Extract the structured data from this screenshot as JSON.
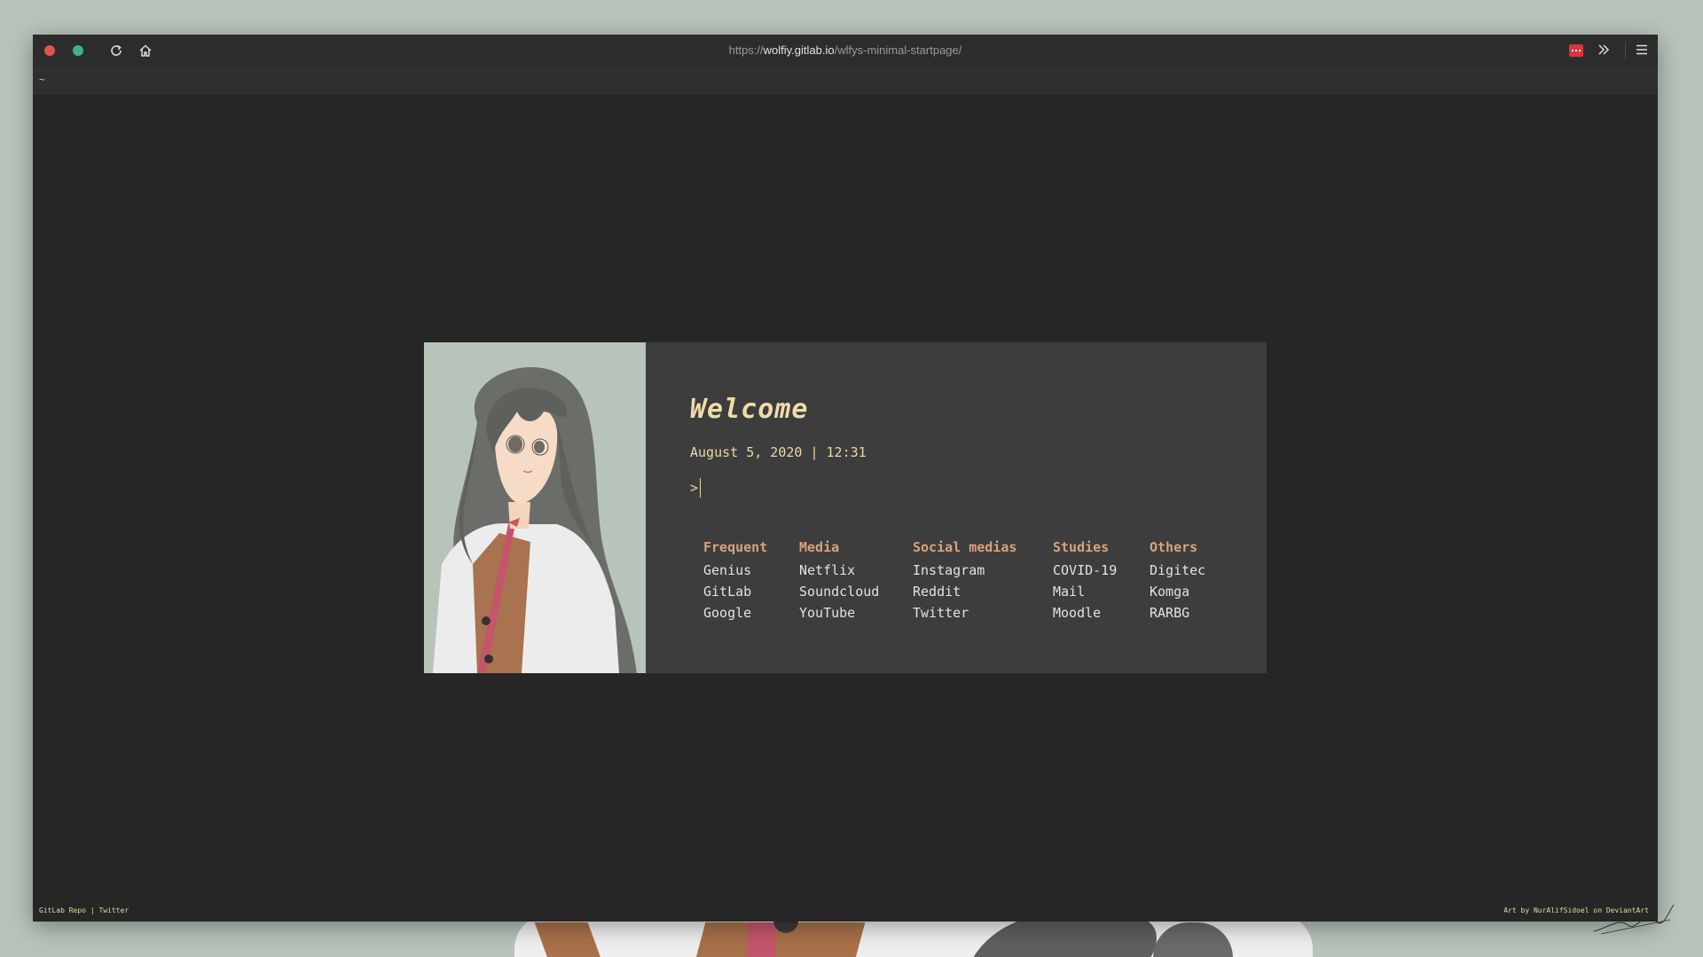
{
  "browser": {
    "url_scheme": "https://",
    "url_host": "wolfiy.gitlab.io",
    "url_path": "/wlfys-minimal-startpage/",
    "tab_title": "~"
  },
  "startpage": {
    "welcome": "Welcome",
    "datetime": "August 5, 2020 | 12:31",
    "prompt": ">",
    "columns": [
      {
        "heading": "Frequent",
        "links": [
          "Genius",
          "GitLab",
          "Google"
        ]
      },
      {
        "heading": "Media",
        "links": [
          "Netflix",
          "Soundcloud",
          "YouTube"
        ]
      },
      {
        "heading": "Social medias",
        "links": [
          "Instagram",
          "Reddit",
          "Twitter"
        ]
      },
      {
        "heading": "Studies",
        "links": [
          "COVID-19",
          "Mail",
          "Moodle"
        ]
      },
      {
        "heading": "Others",
        "links": [
          "Digitec",
          "Komga",
          "RARBG"
        ]
      }
    ]
  },
  "footer": {
    "left_link1": "GitLab Repo",
    "left_sep": "|",
    "left_link2": "Twitter",
    "right": "Art by NurAlifSidoel on DeviantArt"
  },
  "colors": {
    "background": "#262626",
    "card": "#3d3d3d",
    "accent_heading": "#d9a27a",
    "accent_text": "#ead8a8",
    "wallpaper": "#b8c3ba"
  },
  "icons": [
    "close-dot",
    "maximize-dot",
    "reload-icon",
    "home-icon",
    "extension-icon",
    "overflow-chevron-icon",
    "hamburger-menu-icon"
  ]
}
